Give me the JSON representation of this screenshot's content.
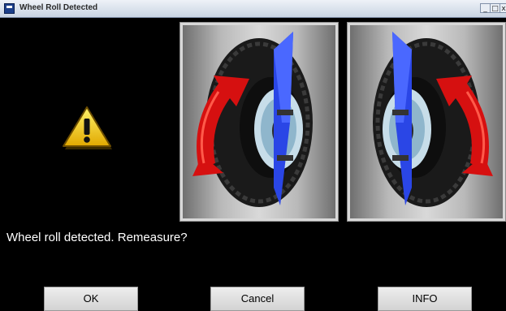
{
  "window": {
    "title": "Wheel Roll Detected",
    "controls": {
      "minimize": "_",
      "maximize": "□",
      "close": "x"
    }
  },
  "dialog": {
    "icon": "warning-icon",
    "illustrations": [
      "wheel-roll-left-image",
      "wheel-roll-right-image"
    ],
    "message": "Wheel roll detected. Remeasure?"
  },
  "buttons": {
    "ok": "OK",
    "cancel": "Cancel",
    "info": "INFO"
  },
  "colors": {
    "background": "#000000",
    "arrow": "#e01414",
    "plane": "#2a46e6",
    "warning": "#f4c400"
  }
}
